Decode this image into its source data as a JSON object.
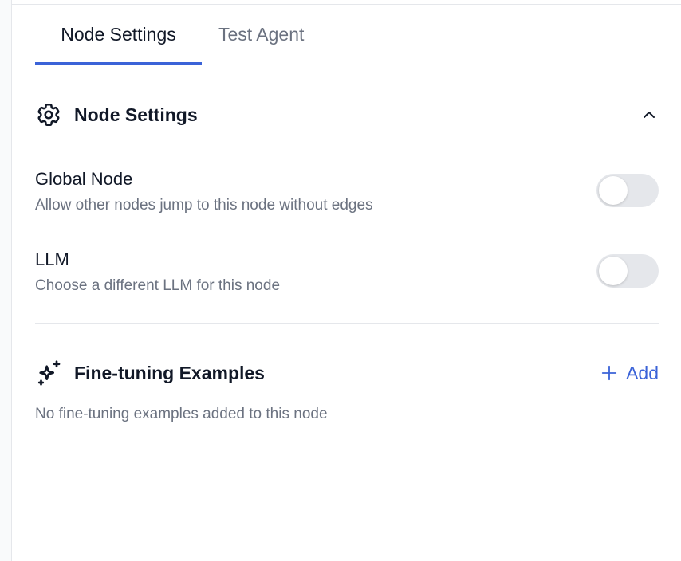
{
  "tabs": [
    {
      "label": "Node Settings",
      "active": true
    },
    {
      "label": "Test Agent",
      "active": false
    }
  ],
  "node_settings": {
    "title": "Node Settings",
    "icon": "gear-icon",
    "collapse_icon": "chevron-up-icon",
    "settings": [
      {
        "label": "Global Node",
        "description": "Allow other nodes jump to this node without edges",
        "enabled": false
      },
      {
        "label": "LLM",
        "description": "Choose a different LLM for this node",
        "enabled": false
      }
    ]
  },
  "fine_tuning": {
    "title": "Fine-tuning Examples",
    "icon": "sparkles-icon",
    "add_label": "Add",
    "empty_text": "No fine-tuning examples added to this node"
  },
  "colors": {
    "accent": "#3b63d8",
    "text_primary": "#111827",
    "text_secondary": "#6b7280",
    "toggle_off": "#e5e7eb",
    "border": "#e5e7eb"
  }
}
